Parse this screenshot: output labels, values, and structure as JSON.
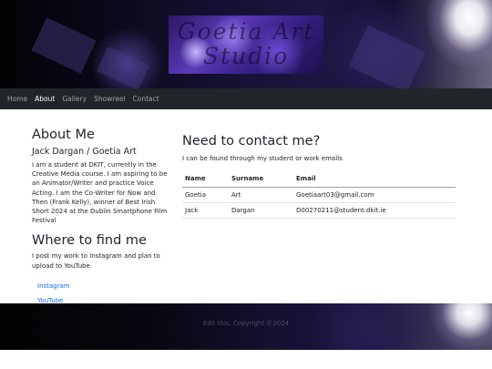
{
  "banner": {
    "logo_text_line1": "Goetia Art",
    "logo_text_line2": "Studio"
  },
  "nav": {
    "items": [
      {
        "label": "Home",
        "active": false
      },
      {
        "label": "About",
        "active": true
      },
      {
        "label": "Gallery",
        "active": false
      },
      {
        "label": "Showreel",
        "active": false
      },
      {
        "label": "Contact",
        "active": false
      }
    ]
  },
  "about": {
    "title": "About Me",
    "subtitle": "Jack Dargan / Goetia Art",
    "bio": "I am a student at DKIT, currently in the Creative Media course. I am aspiring to be an Animator/Writer and practice Voice Acting. I am the Co-Writer for Now and Then (Frank Kelly), winner of Best Irish Short 2024 at the Dublin Smartphone Film Festival"
  },
  "where": {
    "title": "Where to find me",
    "text": "I post my work to Instagram and plan to upload to YouTube",
    "links": [
      "Instagram",
      "YouTube"
    ]
  },
  "contact": {
    "title": "Need to contact me?",
    "lead": "I can be found through my student or work emails",
    "headers": [
      "Name",
      "Surname",
      "Email"
    ],
    "rows": [
      [
        "Goetia",
        "Art",
        "Goetiaart03@gmail.com"
      ],
      [
        "Jack",
        "Dargan",
        "D00270211@student.dkit.ie"
      ]
    ]
  },
  "footer": {
    "text": "Edit this, Copyright ©2024"
  },
  "colors": {
    "navbar": "#212529",
    "link": "#0d6efd",
    "text": "#212529"
  }
}
